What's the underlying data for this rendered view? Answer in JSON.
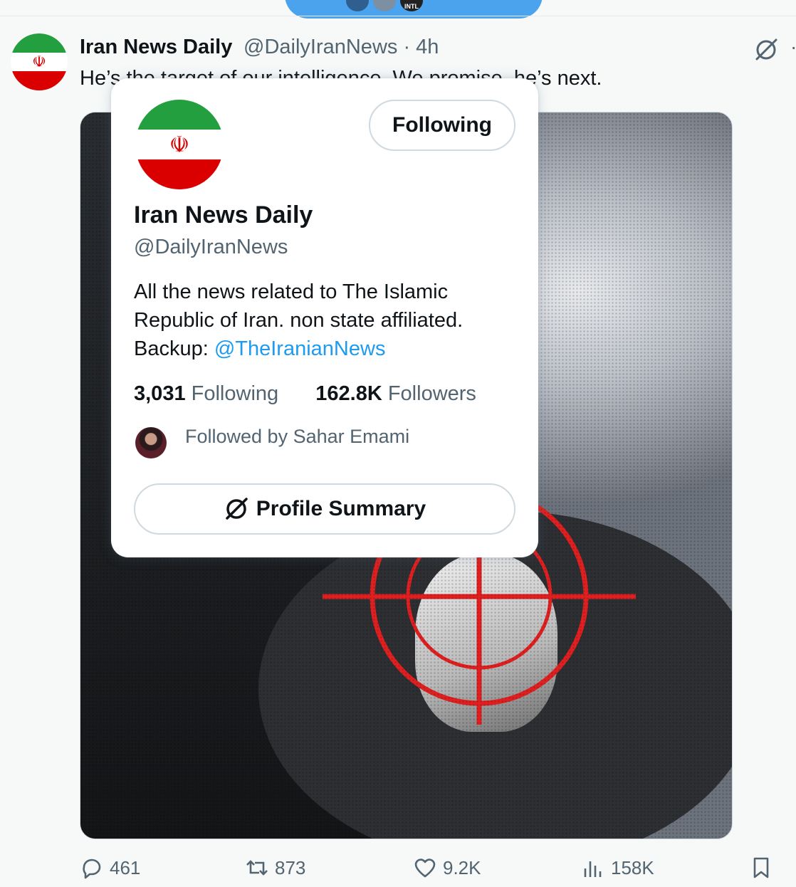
{
  "top_pill": {
    "avatar_badge": "INTL"
  },
  "tweet": {
    "author_name": "Iran News Daily",
    "author_handle": "@DailyIranNews",
    "time": "· 4h",
    "text": "He’s the target of our intelligence. We promise, he’s next."
  },
  "hover_card": {
    "follow_button": "Following",
    "name": "Iran News Daily",
    "handle": "@DailyIranNews",
    "bio_line1": "All the news related to The Islamic",
    "bio_line2": "Republic of Iran. non state affiliated.",
    "bio_backup_label": "Backup: ",
    "bio_backup_link": "@TheIranianNews",
    "following_count": "3,031",
    "following_label": "Following",
    "followers_count": "162.8K",
    "followers_label": "Followers",
    "followed_by": "Followed by Sahar Emami",
    "profile_summary_button": "Profile Summary"
  },
  "actions": {
    "replies": "461",
    "reposts": "873",
    "likes": "9.2K",
    "views": "158K"
  },
  "colors": {
    "link": "#1d9bf0",
    "secondary_text": "#536471",
    "flag_green": "#239f40",
    "flag_red": "#da0000",
    "crosshair": "#e02020"
  }
}
